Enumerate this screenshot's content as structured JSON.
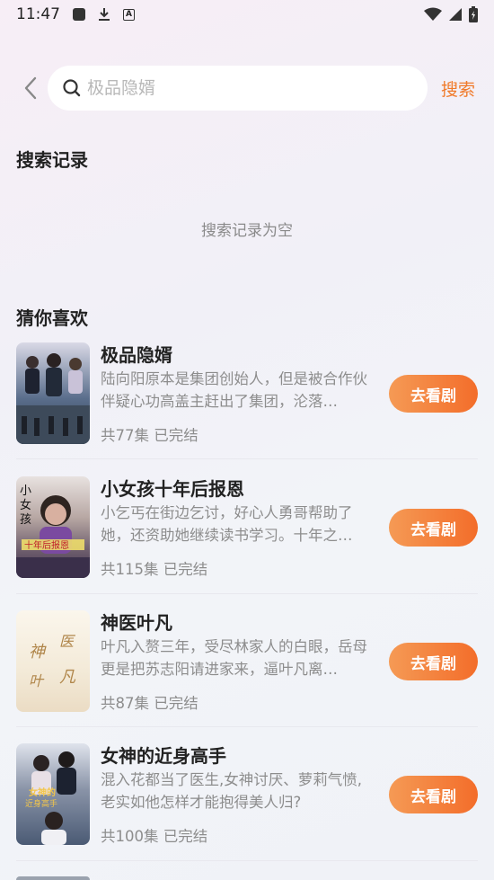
{
  "status": {
    "time": "11:47"
  },
  "search": {
    "placeholder": "极品隐婿",
    "button_label": "搜索"
  },
  "history": {
    "title": "搜索记录",
    "empty_text": "搜索记录为空"
  },
  "recommend": {
    "title": "猜你喜欢",
    "items": [
      {
        "title": "极品隐婿",
        "desc": "陆向阳原本是集团创始人，但是被合作伙伴疑心功高盖主赶出了集团，沦落…",
        "meta": "共77集 已完结",
        "button": "去看剧",
        "cover_color": "#5a6e8c"
      },
      {
        "title": "小女孩十年后报恩",
        "desc": "小乞丐在街边乞讨，好心人勇哥帮助了她，还资助她继续读书学习。十年之…",
        "meta": "共115集 已完结",
        "button": "去看剧",
        "cover_color": "#7b5a6e"
      },
      {
        "title": "神医叶凡",
        "desc": "叶凡入赘三年，受尽林家人的白眼，岳母更是把苏志阳请进家来，逼叶凡离…",
        "meta": "共87集 已完结",
        "button": "去看剧",
        "cover_color": "#f3ead8"
      },
      {
        "title": "女神的近身高手",
        "desc": "混入花都当了医生,女神讨厌、萝莉气愤,老实如他怎样才能抱得美人归?",
        "meta": "共100集 已完结",
        "button": "去看剧",
        "cover_color": "#4a5a74"
      }
    ]
  }
}
